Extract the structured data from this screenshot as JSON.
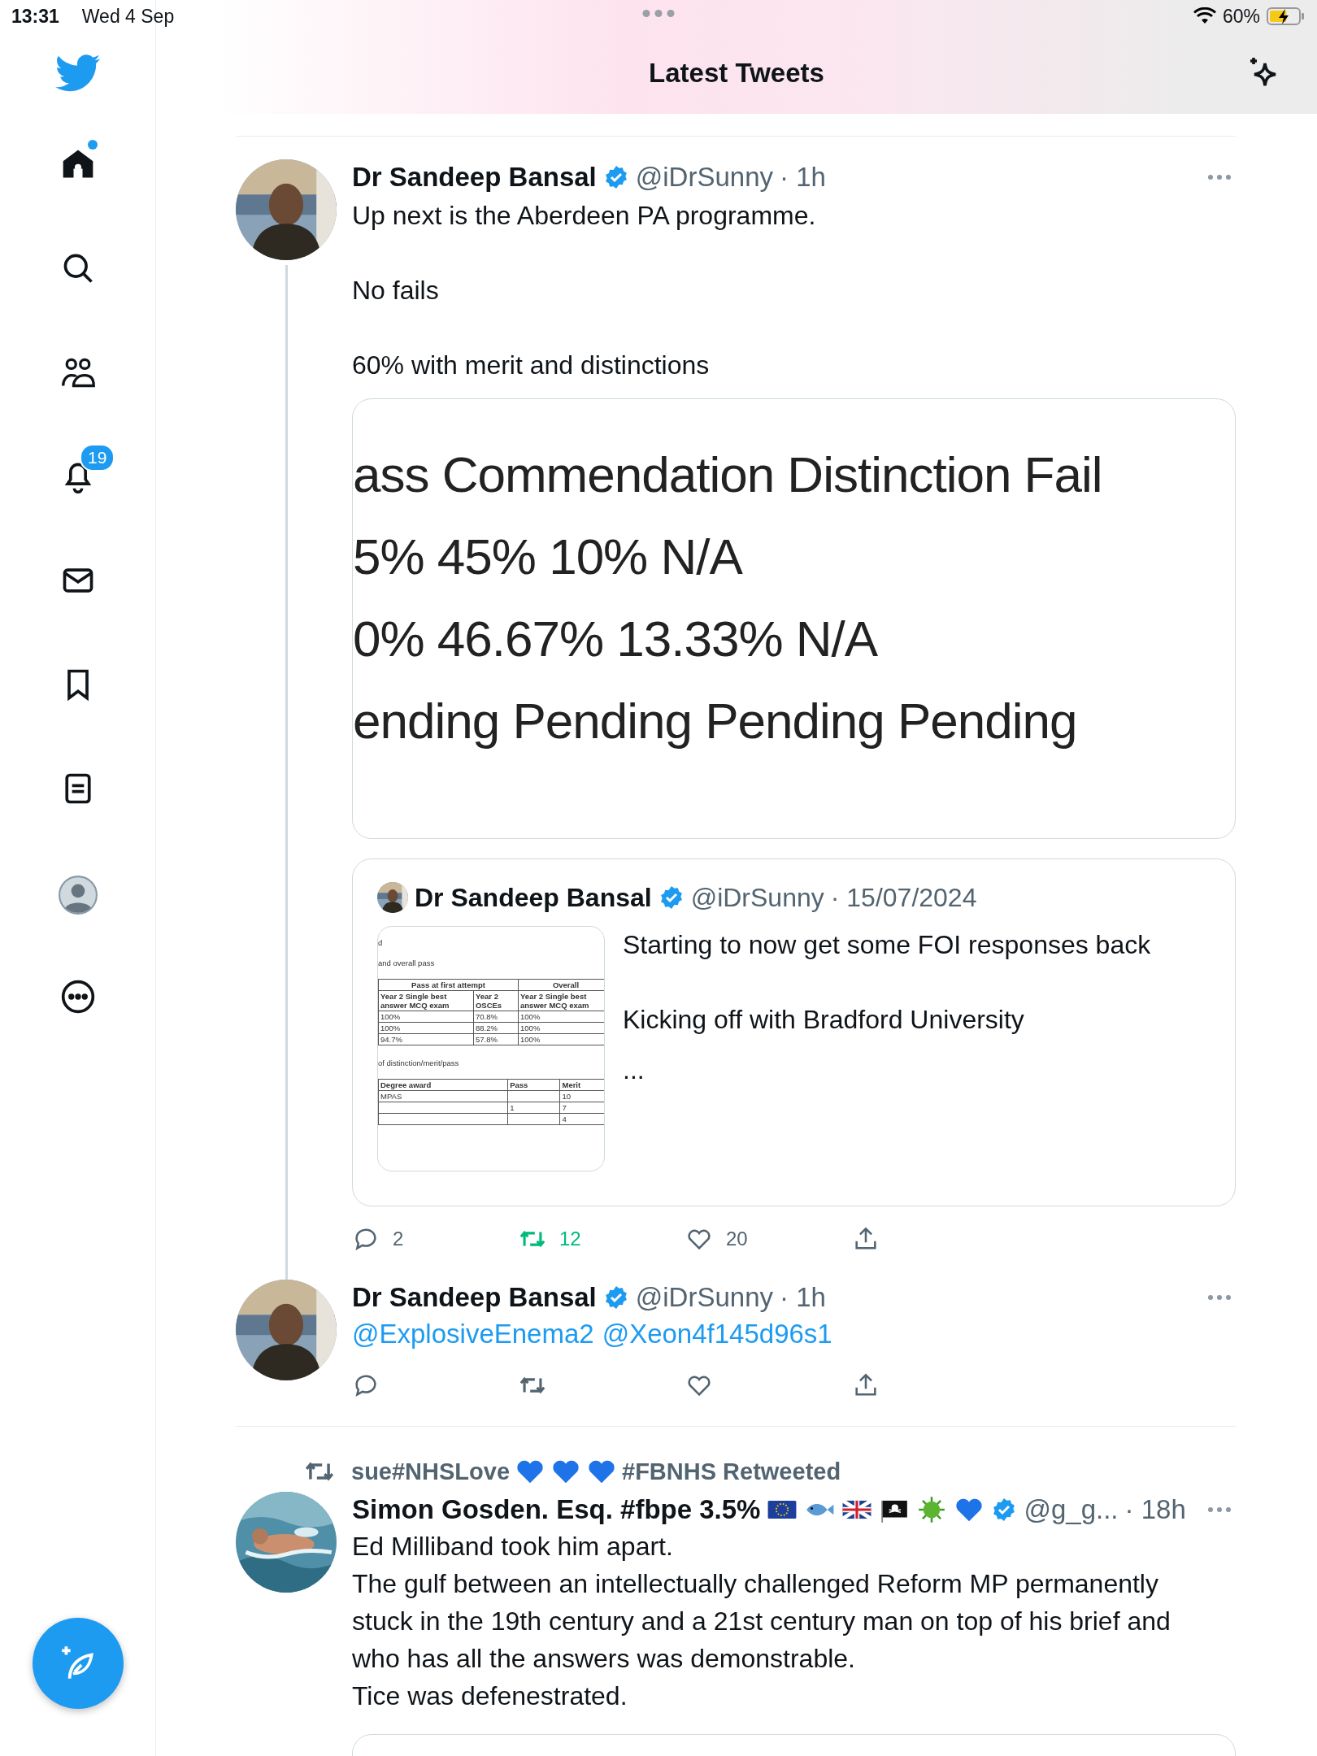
{
  "status_bar": {
    "time": "13:31",
    "date": "Wed 4 Sep",
    "battery": "60%",
    "charging": true
  },
  "sidebar": {
    "items": [
      {
        "kind": "home",
        "selected": true,
        "unread": true
      },
      {
        "kind": "search",
        "selected": false,
        "unread": false
      },
      {
        "kind": "people",
        "selected": false,
        "unread": false
      },
      {
        "kind": "bell",
        "selected": false,
        "unread": false,
        "badge": "19"
      },
      {
        "kind": "mail",
        "selected": false,
        "unread": false
      },
      {
        "kind": "bookmark",
        "selected": false,
        "unread": false
      },
      {
        "kind": "list",
        "selected": false,
        "unread": false
      },
      {
        "kind": "profile",
        "selected": false,
        "unread": false
      },
      {
        "kind": "more",
        "selected": false,
        "unread": false
      }
    ]
  },
  "header": {
    "title": "Latest Tweets"
  },
  "tweets": [
    {
      "name": "Dr Sandeep Bansal",
      "verified": true,
      "handle": "@iDrSunny",
      "time": "· 1h",
      "thread": true,
      "body": [
        "Up next is the Aberdeen PA programme.",
        "No fails",
        "60% with merit and distinctions"
      ],
      "media": {
        "lines": [
          "ass Commendation Distinction Fail",
          "5% 45% 10% N/A",
          "0% 46.67% 13.33% N/A",
          "ending Pending Pending Pending"
        ]
      },
      "quote": {
        "name": "Dr Sandeep Bansal",
        "verified": true,
        "handle": "@iDrSunny",
        "date": "· 15/07/2024",
        "text": [
          "Starting to now get some FOI responses back",
          "Kicking off with Bradford University",
          "..."
        ],
        "thumbnail": {
          "heading": "d",
          "caption_1": "and overall pass",
          "table_1": {
            "group_headers": [
              "Pass at first attempt",
              "Overall"
            ],
            "headers": [
              "Year 2 Single best answer MCQ exam",
              "Year 2 OSCEs",
              "Year 2 Single best answer MCQ exam"
            ],
            "rows": [
              [
                "100%",
                "70.8%",
                "100%"
              ],
              [
                "100%",
                "88.2%",
                "100%"
              ],
              [
                "94.7%",
                "57.8%",
                "100%"
              ]
            ]
          },
          "caption_2": "of distinction/merit/pass",
          "table_2": {
            "headers": [
              "Degree award",
              "Pass",
              "Merit"
            ],
            "rows": [
              [
                "MPAS",
                null,
                "10"
              ],
              [
                null,
                "1",
                "7"
              ],
              [
                null,
                null,
                "4"
              ]
            ]
          }
        }
      },
      "actions": {
        "replies": "2",
        "retweets": "12",
        "retweeted": true,
        "likes": "20",
        "liked": false
      }
    },
    {
      "name": "Dr Sandeep Bansal",
      "verified": true,
      "handle": "@iDrSunny",
      "time": "· 1h",
      "thread": false,
      "mentions": [
        "@ExplosiveEnema2",
        "@Xeon4f145d96s1"
      ],
      "actions": {
        "retweeted": false,
        "liked": false
      }
    },
    {
      "retweeted_by": {
        "prefix": "sue#NHSLove",
        "suffix": "#FBNHS Retweeted"
      },
      "name": "Simon Gosden. Esq. #fbpe 3.5%",
      "verified": true,
      "handle": "@g_g...",
      "time": "· 18h",
      "thread": false,
      "body": [
        "Ed Milliband took him apart.\nThe gulf between an intellectually challenged Reform MP permanently stuck in the 19th century and a 21st century man on top of his brief and who has all the answers was demonstrable.\nTice was defenestrated."
      ],
      "quote_preview": true
    }
  ]
}
